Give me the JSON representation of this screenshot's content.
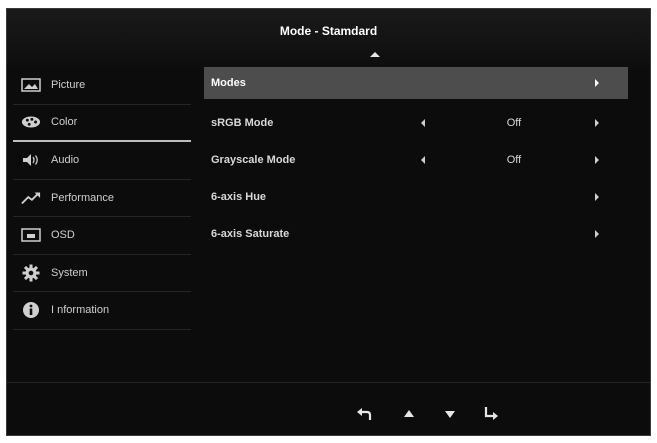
{
  "header": {
    "title": "Mode - Stamdard"
  },
  "sidebar": {
    "items": [
      {
        "label": "Picture",
        "icon": "picture-icon",
        "active": false
      },
      {
        "label": "Color",
        "icon": "color-palette-icon",
        "active": true
      },
      {
        "label": "Audio",
        "icon": "speaker-icon",
        "active": false
      },
      {
        "label": "Performance",
        "icon": "performance-chart-icon",
        "active": false
      },
      {
        "label": "OSD",
        "icon": "osd-screen-icon",
        "active": false
      },
      {
        "label": "System",
        "icon": "gear-icon",
        "active": false
      },
      {
        "label": "I nformation",
        "icon": "info-icon",
        "active": false
      }
    ]
  },
  "menu": {
    "rows": [
      {
        "label": "Modes",
        "value": "",
        "selected": true
      },
      {
        "label": "sRGB Mode",
        "value": "Off",
        "selected": false
      },
      {
        "label": "Grayscale Mode",
        "value": "Off",
        "selected": false
      },
      {
        "label": "6-axis Hue",
        "value": "",
        "selected": false
      },
      {
        "label": "6-axis Saturate",
        "value": "",
        "selected": false
      }
    ]
  },
  "footer": {
    "buttons": [
      "back-icon",
      "up-arrow-icon",
      "down-arrow-icon",
      "enter-icon"
    ]
  },
  "colors": {
    "background": "#0c0c0c",
    "selected_row": "#4d4d4d",
    "text": "#d8d8d8"
  }
}
